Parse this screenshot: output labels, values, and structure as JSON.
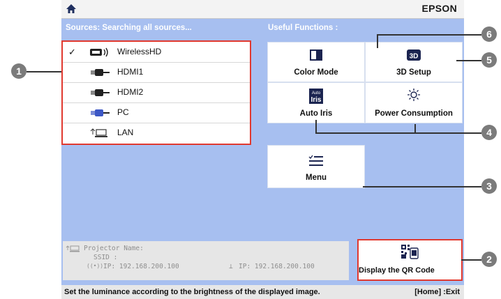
{
  "header": {
    "brand": "EPSON",
    "home_icon": "home-icon"
  },
  "sources": {
    "title": "Sources: Searching all sources...",
    "items": [
      {
        "label": "WirelessHD",
        "icon": "wirelesshd-icon",
        "checked": true,
        "check": "✓"
      },
      {
        "label": "HDMI1",
        "icon": "hdmi-icon"
      },
      {
        "label": "HDMI2",
        "icon": "hdmi-icon"
      },
      {
        "label": "PC",
        "icon": "pc-icon"
      },
      {
        "label": "LAN",
        "icon": "lan-icon"
      }
    ]
  },
  "useful": {
    "title": "Useful Functions :",
    "tiles": [
      {
        "label": "Color Mode",
        "icon": "color-mode-icon"
      },
      {
        "label": "3D Setup",
        "icon": "3d-icon"
      },
      {
        "label": "Auto Iris",
        "icon": "auto-iris-icon",
        "icon_text_top": "Auto",
        "icon_text_bottom": "Iris"
      },
      {
        "label": "Power Consumption",
        "icon": "power-consumption-icon"
      },
      {
        "label": "Menu",
        "icon": "menu-icon"
      }
    ],
    "qr": {
      "label": "Display the QR Code",
      "icon": "qr-code-icon"
    }
  },
  "info": {
    "projector_name": "Projector Name:",
    "ssid": "SSID :",
    "wireless_ip": "IP: 192.168.200.100",
    "wired_ip": "IP: 192.168.200.100"
  },
  "status": {
    "message": "Set the luminance according to the brightness of the displayed image.",
    "exit": "[Home] :Exit"
  },
  "callouts": [
    "1",
    "2",
    "3",
    "4",
    "5",
    "6"
  ],
  "colors": {
    "screen_bg": "#a7bff0",
    "highlight": "#e1392f",
    "badge": "#7b7b7b"
  }
}
